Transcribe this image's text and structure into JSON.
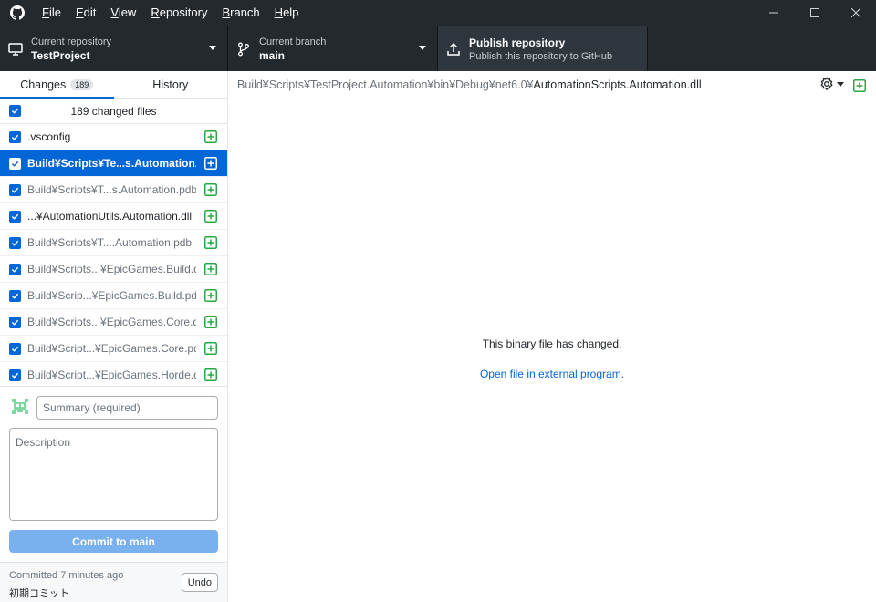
{
  "menu": {
    "items": [
      {
        "first": "F",
        "rest": "ile"
      },
      {
        "first": "E",
        "rest": "dit"
      },
      {
        "first": "V",
        "rest": "iew"
      },
      {
        "first": "R",
        "rest": "epository"
      },
      {
        "first": "B",
        "rest": "ranch"
      },
      {
        "first": "H",
        "rest": "elp"
      }
    ]
  },
  "toolbar": {
    "repo": {
      "label": "Current repository",
      "value": "TestProject"
    },
    "branch": {
      "label": "Current branch",
      "value": "main"
    },
    "publish": {
      "title": "Publish repository",
      "subtitle": "Publish this repository to GitHub"
    }
  },
  "sidebar": {
    "tabs": [
      {
        "label": "Changes",
        "badge": "189"
      },
      {
        "label": "History"
      }
    ],
    "changed_count_label": "189 changed files",
    "files": [
      {
        "name": ".vsconfig"
      },
      {
        "name": "Build¥Scripts¥Te...s.Automation.dll"
      },
      {
        "name": "Build¥Scripts¥T...s.Automation.pdb"
      },
      {
        "name": "...¥AutomationUtils.Automation.dll"
      },
      {
        "name": "Build¥Scripts¥T....Automation.pdb"
      },
      {
        "name": "Build¥Scripts...¥EpicGames.Build.dll"
      },
      {
        "name": "Build¥Scrip...¥EpicGames.Build.pdb"
      },
      {
        "name": "Build¥Scripts...¥EpicGames.Core.dll"
      },
      {
        "name": "Build¥Script...¥EpicGames.Core.pdb"
      },
      {
        "name": "Build¥Script...¥EpicGames.Horde.dll"
      }
    ],
    "commit": {
      "summary_placeholder": "Summary (required)",
      "description_placeholder": "Description",
      "button_prefix": "Commit to ",
      "button_branch": "main"
    },
    "last_commit": {
      "when": "Committed 7 minutes ago",
      "message": "初期コミット",
      "undo_label": "Undo"
    }
  },
  "diff": {
    "path_dir": "Build¥Scripts¥TestProject.Automation¥bin¥Debug¥net6.0¥",
    "path_file": "AutomationScripts.Automation.dll",
    "binary_message": "This binary file has changed.",
    "open_link": "Open file in external program."
  },
  "colors": {
    "titlebar": "#24292e",
    "accent": "#0366d6",
    "added": "#28a745",
    "commit_button": "#79b1ee"
  }
}
